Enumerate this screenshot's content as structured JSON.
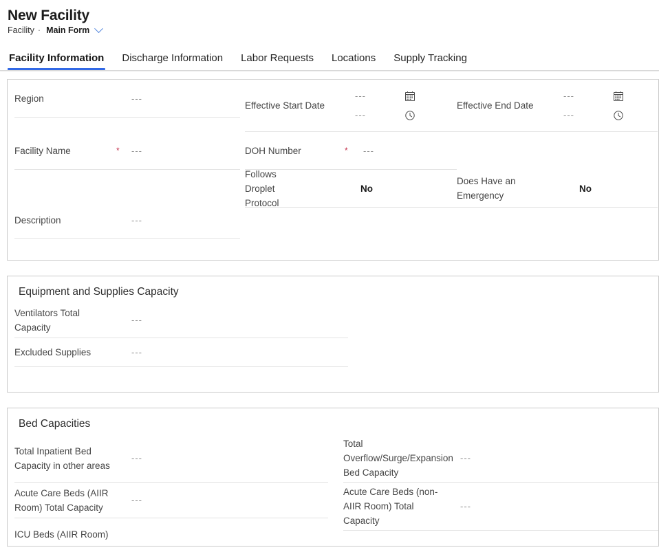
{
  "header": {
    "title": "New Facility",
    "entity": "Facility",
    "separator": "·",
    "form_name": "Main Form",
    "chevron_icon": "chevron-down-icon"
  },
  "tabs": [
    {
      "label": "Facility Information",
      "active": true
    },
    {
      "label": "Discharge Information",
      "active": false
    },
    {
      "label": "Labor Requests",
      "active": false
    },
    {
      "label": "Locations",
      "active": false
    },
    {
      "label": "Supply Tracking",
      "active": false
    }
  ],
  "placeholder": "---",
  "sections": [
    {
      "id": "facility-details",
      "title": "",
      "fields": {
        "region": {
          "label": "Region",
          "value": "---",
          "required": false
        },
        "facility_name": {
          "label": "Facility Name",
          "value": "---",
          "required": true
        },
        "description": {
          "label": "Description",
          "value": "---",
          "required": false
        },
        "effective_start_date": {
          "label": "Effective Start Date",
          "date_value": "---",
          "time_value": "---",
          "date_icon": "calendar-icon",
          "time_icon": "clock-icon"
        },
        "effective_end_date": {
          "label": "Effective End Date",
          "date_value": "---",
          "time_value": "---",
          "date_icon": "calendar-icon",
          "time_icon": "clock-icon"
        },
        "doh_number": {
          "label": "DOH Number",
          "value": "---",
          "required": true
        },
        "follows_droplet_protocol": {
          "label": "Follows Droplet Protocol",
          "value": "No",
          "required": false
        },
        "does_have_an_emergency": {
          "label": "Does Have an Emergency",
          "value": "No",
          "required": false
        }
      }
    },
    {
      "id": "equipment-supplies-capacity",
      "title": "Equipment and Supplies Capacity",
      "fields": {
        "ventilators_total_capacity": {
          "label": "Ventilators Total Capacity",
          "value": "---"
        },
        "excluded_supplies": {
          "label": "Excluded Supplies",
          "value": "---"
        }
      }
    },
    {
      "id": "bed-capacities",
      "title": "Bed Capacities",
      "fields": {
        "total_inpatient_bed_capacity_other": {
          "label": "Total Inpatient Bed Capacity in other areas",
          "value": "---"
        },
        "acute_care_beds_aiir": {
          "label": "Acute Care Beds (AIIR Room) Total Capacity",
          "value": "---"
        },
        "icu_beds_aiir": {
          "label": "ICU Beds (AIIR Room)",
          "value": ""
        },
        "total_overflow_surge": {
          "label": "Total Overflow/Surge/Expansion Bed Capacity",
          "value": "---"
        },
        "acute_care_beds_non_aiir": {
          "label": "Acute Care Beds (non-AIIR Room) Total Capacity",
          "value": "---"
        }
      }
    }
  ],
  "colors": {
    "accent": "#3269e6",
    "required_asterisk": "#c4314b",
    "label_text": "#454545",
    "value_placeholder": "#8a8a8a",
    "card_border": "#c9c9c9",
    "row_divider": "#e3e3e3"
  }
}
